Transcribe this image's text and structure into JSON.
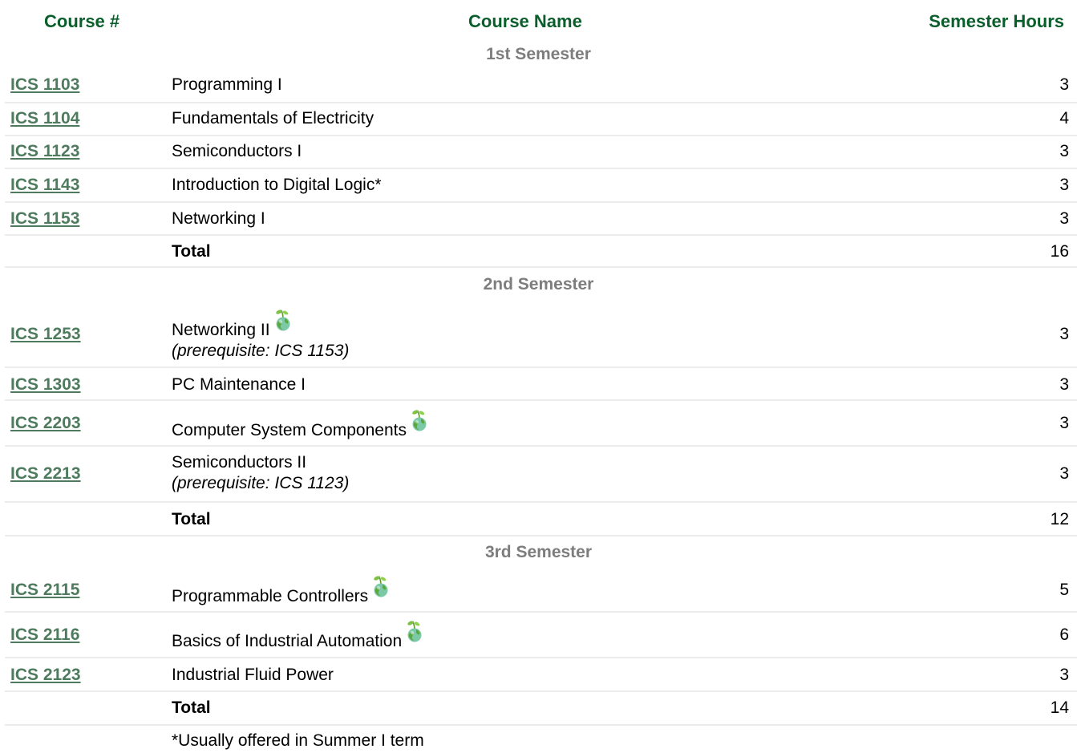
{
  "header": {
    "course_num": "Course #",
    "course_name": "Course Name",
    "semester_hours": "Semester Hours"
  },
  "semesters": [
    {
      "title": "1st Semester",
      "courses": [
        {
          "code": "ICS 1103",
          "name": "Programming I",
          "hours": "3"
        },
        {
          "code": "ICS 1104",
          "name": "Fundamentals of Electricity",
          "hours": "4"
        },
        {
          "code": "ICS 1123",
          "name": "Semiconductors I",
          "hours": "3"
        },
        {
          "code": "ICS 1143",
          "name": "Introduction to Digital Logic*",
          "hours": "3"
        },
        {
          "code": "ICS 1153",
          "name": "Networking I",
          "hours": "3"
        }
      ],
      "total_label": "Total",
      "total_hours": "16"
    },
    {
      "title": "2nd Semester",
      "courses": [
        {
          "code": "ICS 1253",
          "name": "Networking II",
          "prereq": "(prerequisite: ICS 1153)",
          "hours": "3",
          "green_icon": "green-globe-sprout-icon"
        },
        {
          "code": "ICS 1303",
          "name": "PC Maintenance I",
          "hours": "3"
        },
        {
          "code": "ICS 2203",
          "name": "Computer System Components",
          "hours": "3",
          "green_icon": "green-globe-sprout-icon"
        },
        {
          "code": "ICS 2213",
          "name": "Semiconductors II",
          "prereq": "(prerequisite: ICS 1123)",
          "hours": "3"
        }
      ],
      "total_label": "Total",
      "total_hours": "12"
    },
    {
      "title": "3rd Semester",
      "courses": [
        {
          "code": "ICS 2115",
          "name": "Programmable Controllers",
          "hours": "5",
          "green_icon": "green-globe-sprout-icon"
        },
        {
          "code": "ICS 2116",
          "name": "Basics of Industrial Automation",
          "hours": "6",
          "green_icon": "green-globe-sprout-icon"
        },
        {
          "code": "ICS 2123",
          "name": "Industrial Fluid Power",
          "hours": "3"
        }
      ],
      "total_label": "Total",
      "total_hours": "14"
    }
  ],
  "footnote": "*Usually offered in Summer I term",
  "colors": {
    "header_green": "#0a5e2b",
    "link_green": "#4e7b5d",
    "semester_gray": "#7d7d7d",
    "divider": "#ececec"
  }
}
